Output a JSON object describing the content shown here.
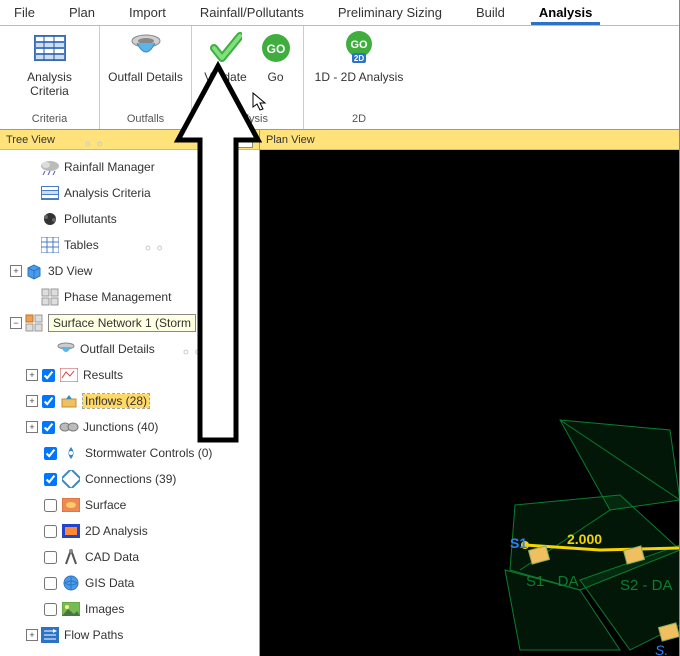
{
  "tabs": {
    "file": "File",
    "plan": "Plan",
    "import": "Import",
    "rainfall": "Rainfall/Pollutants",
    "sizing": "Preliminary Sizing",
    "build": "Build",
    "analysis": "Analysis"
  },
  "ribbon": {
    "criteria": {
      "item": "Analysis Criteria",
      "caption": "Criteria"
    },
    "outfalls": {
      "item": "Outfall Details",
      "caption": "Outfalls"
    },
    "analysis": {
      "validate": "Validate",
      "go": "Go",
      "caption": "Analysis"
    },
    "d2": {
      "item": "1D - 2D Analysis",
      "caption": "2D"
    }
  },
  "panels": {
    "tree_title": "Tree View",
    "plan_title": "Plan View"
  },
  "tree": {
    "rainfall": "Rainfall Manager",
    "analysis_criteria": "Analysis Criteria",
    "pollutants": "Pollutants",
    "tables": "Tables",
    "view3d": "3D View",
    "phase": "Phase Management",
    "surface_net": "Surface Network 1 (Storm",
    "outfall": "Outfall Details",
    "results": "Results",
    "inflows": "Inflows (28)",
    "junctions": "Junctions (40)",
    "sw_controls": "Stormwater Controls (0)",
    "connections": "Connections (39)",
    "surface": "Surface",
    "analysis2d": "2D Analysis",
    "cad": "CAD Data",
    "gis": "GIS Data",
    "images": "Images",
    "flow_paths": "Flow Paths"
  },
  "plan": {
    "labels": {
      "s1": "S1",
      "s1da": "S1 - DA",
      "s2da": "S2 - DA",
      "dist": "2.000"
    }
  }
}
